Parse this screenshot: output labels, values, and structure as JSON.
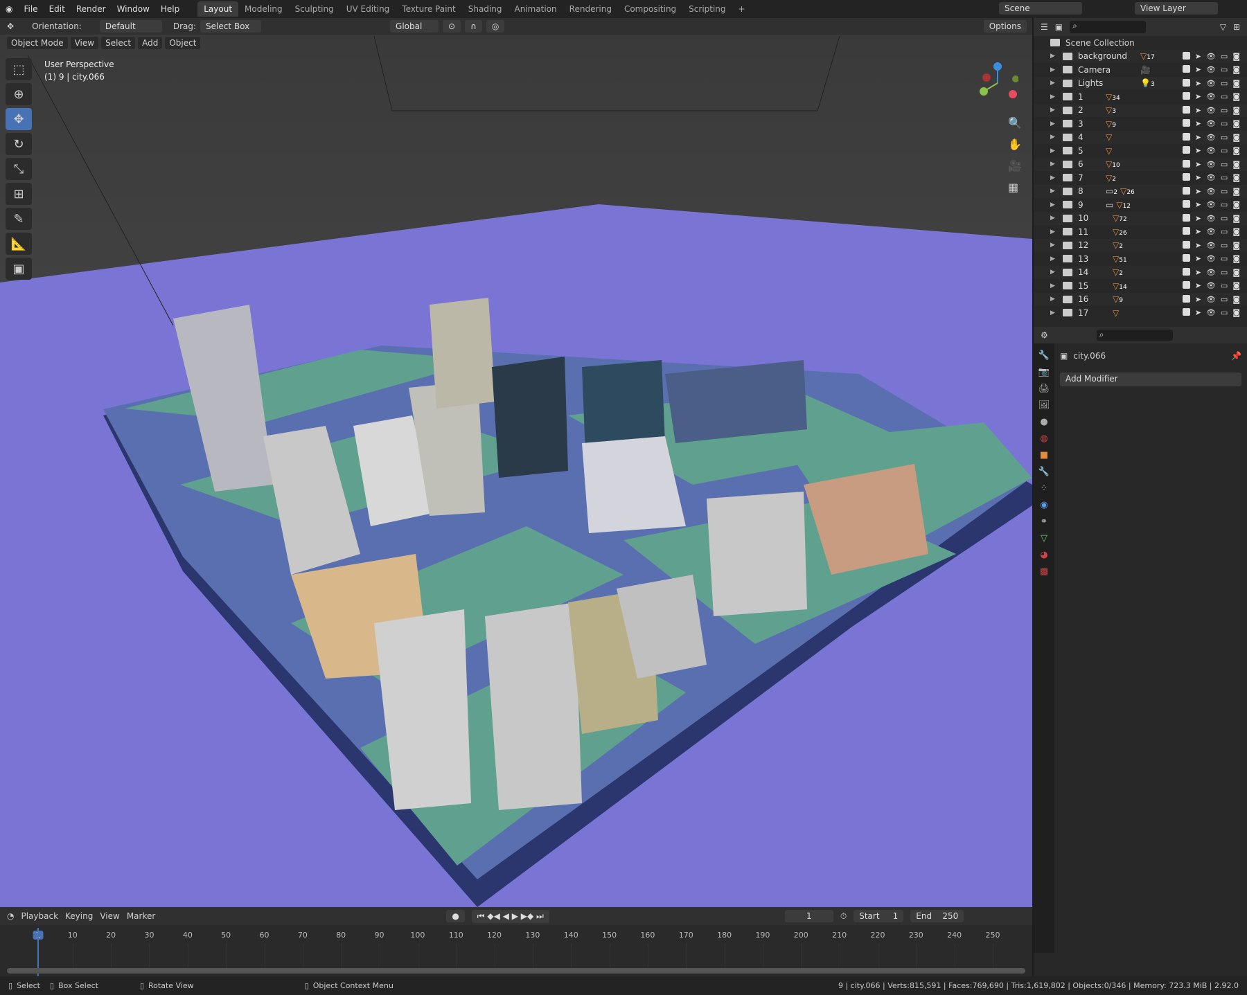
{
  "topbar": {
    "menus": [
      "File",
      "Edit",
      "Render",
      "Window",
      "Help"
    ],
    "workspaces": [
      "Layout",
      "Modeling",
      "Sculpting",
      "UV Editing",
      "Texture Paint",
      "Shading",
      "Animation",
      "Rendering",
      "Compositing",
      "Scripting"
    ],
    "active_workspace": "Layout",
    "scene": "Scene",
    "view_layer": "View Layer"
  },
  "header": {
    "orientation_label": "Orientation:",
    "orientation": "Default",
    "drag_label": "Drag:",
    "drag": "Select Box",
    "transform": "Global",
    "options": "Options"
  },
  "viewport_header": {
    "mode": "Object Mode",
    "menus": [
      "View",
      "Select",
      "Add",
      "Object"
    ]
  },
  "viewport": {
    "perspective": "User Perspective",
    "object": "(1) 9 | city.066",
    "plane_color": "#7a74d4",
    "platform_color": "#5fa08f",
    "base_color": "#2b356e"
  },
  "outliner": {
    "root": "Scene Collection",
    "items": [
      {
        "name": "background",
        "count": "17",
        "icon": "mesh-icon"
      },
      {
        "name": "Camera",
        "count": "",
        "icon": "camera-icon"
      },
      {
        "name": "Lights",
        "count": "3",
        "icon": "light-icon"
      },
      {
        "name": "1",
        "count": "34",
        "icon": "mesh-icon"
      },
      {
        "name": "2",
        "count": "3",
        "icon": "mesh-icon"
      },
      {
        "name": "3",
        "count": "9",
        "icon": "mesh-icon"
      },
      {
        "name": "4",
        "count": "",
        "icon": "mesh-icon"
      },
      {
        "name": "5",
        "count": "",
        "icon": "mesh-icon"
      },
      {
        "name": "6",
        "count": "10",
        "icon": "mesh-icon"
      },
      {
        "name": "7",
        "count": "2",
        "icon": "mesh-icon"
      },
      {
        "name": "8",
        "count": "26",
        "sub": "2",
        "icon": "mesh-icon"
      },
      {
        "name": "9",
        "count": "12",
        "sub": "",
        "icon": "mesh-icon"
      },
      {
        "name": "10",
        "count": "72",
        "icon": "mesh-icon"
      },
      {
        "name": "11",
        "count": "26",
        "icon": "mesh-icon"
      },
      {
        "name": "12",
        "count": "2",
        "icon": "mesh-icon"
      },
      {
        "name": "13",
        "count": "51",
        "icon": "mesh-icon"
      },
      {
        "name": "14",
        "count": "2",
        "icon": "mesh-icon"
      },
      {
        "name": "15",
        "count": "14",
        "icon": "mesh-icon"
      },
      {
        "name": "16",
        "count": "9",
        "icon": "mesh-icon"
      },
      {
        "name": "17",
        "count": "",
        "icon": "mesh-icon"
      }
    ]
  },
  "properties": {
    "object": "city.066",
    "add_modifier": "Add Modifier"
  },
  "timeline": {
    "menus": [
      "Playback",
      "Keying",
      "View",
      "Marker"
    ],
    "current_frame": "1",
    "start_label": "Start",
    "start": "1",
    "end_label": "End",
    "end": "250",
    "ticks": [
      "1",
      "10",
      "20",
      "30",
      "40",
      "50",
      "60",
      "70",
      "80",
      "90",
      "100",
      "110",
      "120",
      "130",
      "140",
      "150",
      "160",
      "170",
      "180",
      "190",
      "200",
      "210",
      "220",
      "230",
      "240",
      "250"
    ]
  },
  "status": {
    "select": "Select",
    "box_select": "Box Select",
    "rotate": "Rotate View",
    "context": "Object Context Menu",
    "stats": "9 | city.066 | Verts:815,591 | Faces:769,690 | Tris:1,619,802 | Objects:0/346 | Memory: 723.3 MiB | 2.92.0"
  }
}
